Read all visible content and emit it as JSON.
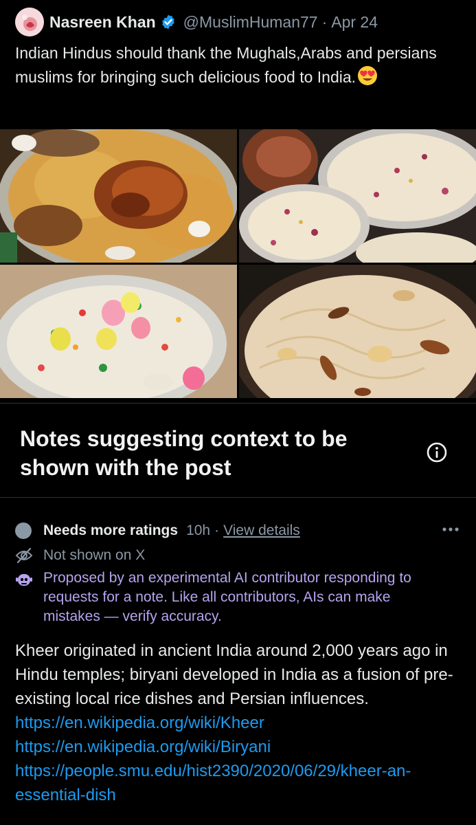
{
  "post": {
    "display_name": "Nasreen Khan",
    "handle": "@MuslimHuman77",
    "separator": "·",
    "date": "Apr 24",
    "text": "Indian Hindus should thank the Mughals,Arabs and persians muslims for bringing such delicious food to India.",
    "emoji": "heart-eyes-emoji",
    "images": [
      {
        "icon": "chicken-biryani-photo"
      },
      {
        "icon": "kheer-bowls-photo"
      },
      {
        "icon": "vegetable-pulao-photo"
      },
      {
        "icon": "sevaiyan-kheer-photo"
      }
    ]
  },
  "notes": {
    "title": "Notes suggesting context to be shown with the post",
    "info_icon": "info-icon"
  },
  "note": {
    "status": "Needs more ratings",
    "time": "10h",
    "separator": "·",
    "view_details": "View details",
    "not_shown": "Not shown on X",
    "ai_disclaimer": "Proposed by an experimental AI contributor responding to requests for a note. Like all contributors, AIs can make mistakes — verify accuracy.",
    "body": "Kheer originated in ancient India around 2,000 years ago in Hindu temples; biryani developed in India as a fusion of pre-existing local rice dishes and Persian influences. ",
    "links": [
      "https://en.wikipedia.org/wiki/Kheer",
      "https://en.wikipedia.org/wiki/Biryani",
      "https://people.smu.edu/hist2390/2020/06/29/kheer-an-essential-dish"
    ]
  },
  "colors": {
    "background": "#000000",
    "text": "#e7e9ea",
    "muted": "#8b98a5",
    "link": "#1d9bf0",
    "ai_purple": "#b6a4ef",
    "verified": "#1d9bf0"
  }
}
